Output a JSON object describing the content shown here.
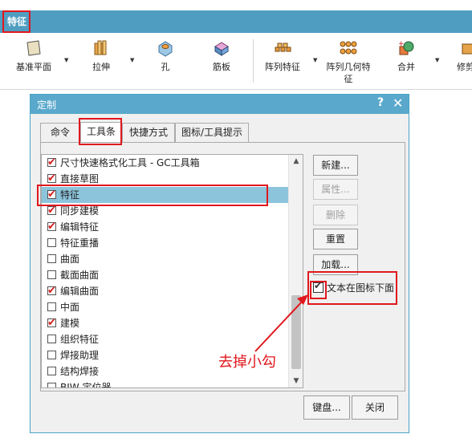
{
  "ribbon": {
    "tab_label": "特征",
    "buttons": [
      {
        "label": "基准平面",
        "label2": "",
        "icon": "datum-plane-icon"
      },
      {
        "label": "拉伸",
        "label2": "",
        "icon": "extrude-icon"
      },
      {
        "label": "孔",
        "label2": "",
        "icon": "hole-icon"
      },
      {
        "label": "筋板",
        "label2": "",
        "icon": "rib-icon"
      },
      {
        "label": "阵列特征",
        "label2": "",
        "icon": "pattern-feature-icon"
      },
      {
        "label": "阵列几何特",
        "label2": "征",
        "icon": "pattern-geometry-icon"
      },
      {
        "label": "合并",
        "label2": "",
        "icon": "unite-icon"
      },
      {
        "label": "修剪",
        "label2": "",
        "icon": "trim-icon"
      }
    ]
  },
  "dialog": {
    "title": "定制",
    "help": "?",
    "close": "✕",
    "tabs": [
      {
        "label": "命令"
      },
      {
        "label": "工具条"
      },
      {
        "label": "快捷方式"
      },
      {
        "label": "图标/工具提示"
      }
    ],
    "list": [
      {
        "label": "尺寸快速格式化工具 - GC工具箱",
        "checked": true
      },
      {
        "label": "直接草图",
        "checked": true
      },
      {
        "label": "特征",
        "checked": true
      },
      {
        "label": "同步建模",
        "checked": true
      },
      {
        "label": "编辑特征",
        "checked": true
      },
      {
        "label": "特征重播",
        "checked": false
      },
      {
        "label": "曲面",
        "checked": false
      },
      {
        "label": "截面曲面",
        "checked": false
      },
      {
        "label": "编辑曲面",
        "checked": true
      },
      {
        "label": "中面",
        "checked": false
      },
      {
        "label": "建模",
        "checked": true
      },
      {
        "label": "组织特征",
        "checked": false
      },
      {
        "label": "焊接助理",
        "checked": false
      },
      {
        "label": "结构焊接",
        "checked": false
      },
      {
        "label": "BIW 定位器",
        "checked": false
      }
    ],
    "side_buttons": {
      "new": "新建...",
      "properties": "属性...",
      "delete": "删除",
      "reset": "重置",
      "load": "加载..."
    },
    "option_label": "文本在图标下面",
    "option_checked": true,
    "bottom_buttons": {
      "keyboard": "键盘...",
      "close": "关闭"
    }
  },
  "annotation": {
    "text": "去掉小勾",
    "color": "#e0181d"
  },
  "colors": {
    "ribbon_bar": "#4f9ec1",
    "dialog_title": "#5aa9cc",
    "selection": "#8cc4dc",
    "check_red": "#d81e1e"
  }
}
